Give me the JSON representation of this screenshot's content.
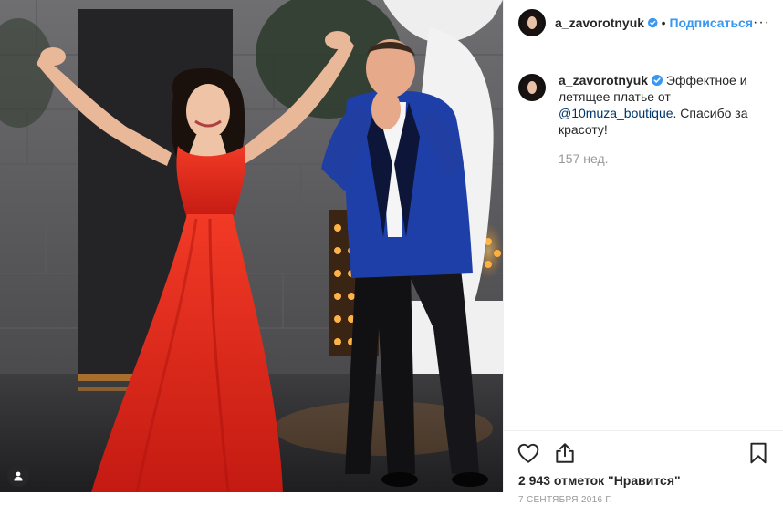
{
  "header": {
    "username": "a_zavorotnyuk",
    "separator": "•",
    "follow_label": "Подписаться",
    "more_label": "···"
  },
  "caption": {
    "username": "a_zavorotnyuk",
    "text_before": " Эффектное и летящее платье от ",
    "mention": "@10muza_boutique",
    "text_after": ". Спасибо за красоту!",
    "age": "157 нед."
  },
  "actions": {
    "likes": "2 943 отметок \"Нравится\"",
    "date": "7 сентября 2016 г."
  },
  "colors": {
    "accent": "#3897f0",
    "verified": "#3897f0",
    "mention": "#003569",
    "dress": "#e8281c",
    "jacket": "#1c3a9e"
  },
  "icons": [
    "verified-badge-icon",
    "heart-icon",
    "share-icon",
    "bookmark-icon",
    "user-tag-icon"
  ]
}
